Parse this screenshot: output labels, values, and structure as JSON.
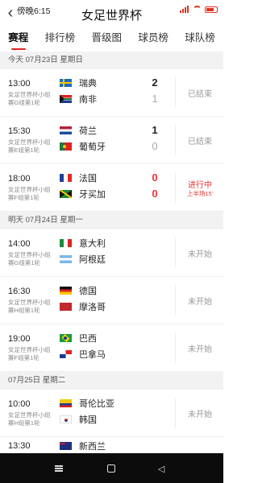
{
  "status_bar": {
    "time": "傍晚6:15"
  },
  "header": {
    "title": "女足世界杯"
  },
  "tabs": [
    {
      "label": "赛程",
      "active": true
    },
    {
      "label": "排行榜"
    },
    {
      "label": "晋级图"
    },
    {
      "label": "球员榜"
    },
    {
      "label": "球队榜"
    }
  ],
  "days": [
    {
      "header": "今天 07月23日 星期日",
      "matches": [
        {
          "time": "13:00",
          "competition": "女足世界杯小组赛G组第1轮",
          "home": {
            "name": "瑞典",
            "flag": "flag-sweden-icon"
          },
          "away": {
            "name": "南非",
            "flag": "flag-south-africa-icon"
          },
          "home_score": "2",
          "away_score": "1",
          "status": "已结束"
        },
        {
          "time": "15:30",
          "competition": "女足世界杯小组赛E组第1轮",
          "home": {
            "name": "荷兰",
            "flag": "flag-netherlands-icon"
          },
          "away": {
            "name": "葡萄牙",
            "flag": "flag-portugal-icon"
          },
          "home_score": "1",
          "away_score": "0",
          "status": "已结束"
        },
        {
          "time": "18:00",
          "competition": "女足世界杯小组赛F组第1轮",
          "home": {
            "name": "法国",
            "flag": "flag-france-icon"
          },
          "away": {
            "name": "牙买加",
            "flag": "flag-jamaica-icon"
          },
          "home_score": "0",
          "away_score": "0",
          "status": "进行中",
          "detail": "上半场15'"
        }
      ]
    },
    {
      "header": "明天 07月24日 星期一",
      "matches": [
        {
          "time": "14:00",
          "competition": "女足世界杯小组赛G组第1轮",
          "home": {
            "name": "意大利",
            "flag": "flag-italy-icon"
          },
          "away": {
            "name": "阿根廷",
            "flag": "flag-argentina-icon"
          },
          "status": "未开始"
        },
        {
          "time": "16:30",
          "competition": "女足世界杯小组赛H组第1轮",
          "home": {
            "name": "德国",
            "flag": "flag-germany-icon"
          },
          "away": {
            "name": "摩洛哥",
            "flag": "flag-morocco-icon"
          },
          "status": "未开始"
        },
        {
          "time": "19:00",
          "competition": "女足世界杯小组赛F组第1轮",
          "home": {
            "name": "巴西",
            "flag": "flag-brazil-icon"
          },
          "away": {
            "name": "巴拿马",
            "flag": "flag-panama-icon"
          },
          "status": "未开始"
        }
      ]
    },
    {
      "header": "07月25日 星期二",
      "matches": [
        {
          "time": "10:00",
          "competition": "女足世界杯小组赛H组第1轮",
          "home": {
            "name": "哥伦比亚",
            "flag": "flag-colombia-icon"
          },
          "away": {
            "name": "韩国",
            "flag": "flag-south-korea-icon"
          },
          "status": "未开始"
        }
      ],
      "partial": {
        "time": "13:30",
        "home": {
          "name": "新西兰",
          "flag": "flag-new-zealand-icon"
        }
      }
    }
  ],
  "colors": {
    "accent": "#dd2222",
    "live": "#ee3333",
    "muted": "#999999",
    "date_bg": "#f2f2f2"
  }
}
